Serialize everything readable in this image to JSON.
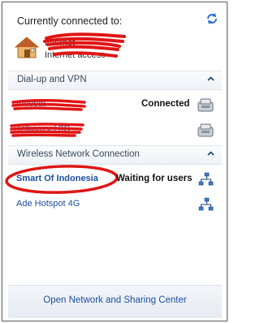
{
  "header": {
    "title": "Currently connected to:",
    "network_line1": "Internet",
    "network_line2": "Internet access"
  },
  "sections": {
    "dialup": {
      "label": "Dial-up and VPN",
      "items": [
        {
          "name": "Indosat",
          "status": "Connected"
        },
        {
          "name": "Telkomsel 3G",
          "status": ""
        }
      ]
    },
    "wireless": {
      "label": "Wireless Network Connection",
      "items": [
        {
          "name": "Smart Of Indonesia",
          "status": "Waiting for users"
        },
        {
          "name": "Ade Hotspot 4G",
          "status": ""
        }
      ]
    }
  },
  "footer": {
    "link": "Open Network and Sharing Center"
  },
  "colors": {
    "link": "#1c4fa0",
    "annotation_red": "#e01515",
    "section_text": "#3c4a5a"
  },
  "icons": [
    "refresh-icon",
    "house-icon",
    "modem-icon",
    "wifi-signal-icon",
    "chevron-up-icon"
  ]
}
